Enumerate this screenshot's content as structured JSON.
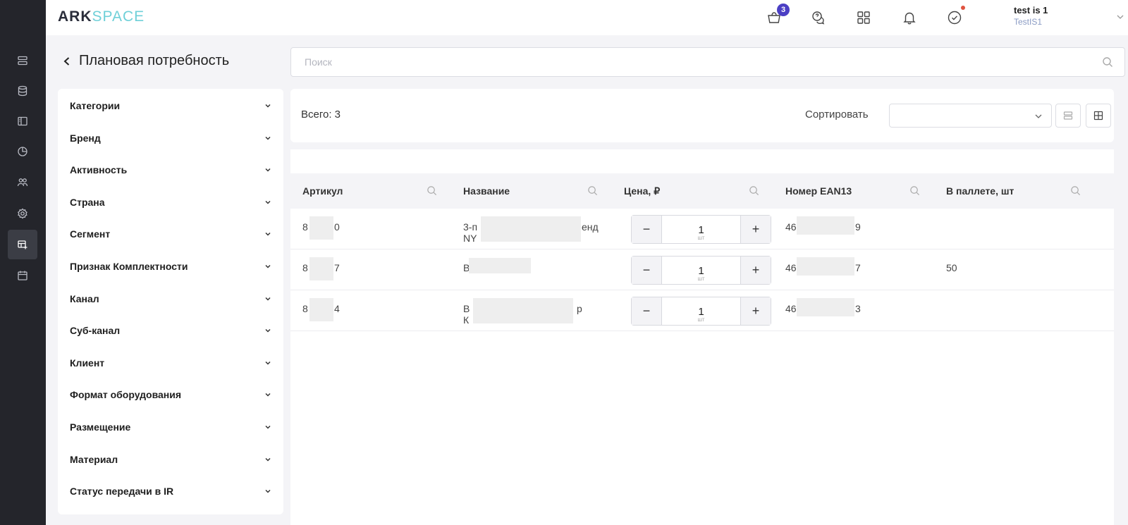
{
  "app": {
    "logo_ark": "ARK",
    "logo_space": "SPACE"
  },
  "header": {
    "cart_count": "3",
    "user_name": "test is 1",
    "user_org": "TestIS1",
    "icons": [
      "cart-icon",
      "chat-icon",
      "apps-grid-icon",
      "bell-icon",
      "check-circle-icon",
      "chevron-down-icon"
    ]
  },
  "sidebar": {
    "items": [
      "stack-icon",
      "database-icon",
      "layout-icon",
      "pie-chart-icon",
      "users-icon",
      "settings-icon",
      "table-add-icon",
      "calendar-icon"
    ],
    "active_index": 6
  },
  "page": {
    "title": "Плановая потребность"
  },
  "search": {
    "placeholder": "Поиск"
  },
  "filters": {
    "items": [
      "Категории",
      "Бренд",
      "Активность",
      "Страна",
      "Сегмент",
      "Признак Комплектности",
      "Канал",
      "Суб-канал",
      "Клиент",
      "Формат оборудования",
      "Размещение",
      "Материал",
      "Статус передачи в IR"
    ]
  },
  "toolbar": {
    "total_label": "Всего: 3",
    "sort_label": "Сортировать",
    "sort_value": ""
  },
  "table": {
    "columns": [
      "Артикул",
      "Название",
      "Цена, ₽",
      "Номер EAN13",
      "В паллете, шт"
    ],
    "rows": [
      {
        "article_start": "8",
        "article_end": "0",
        "name_line1_start": "3-п",
        "name_line1_end": "енд",
        "name_line2_start": "NY",
        "qty": "1",
        "unit": "шт",
        "ean_start": "46",
        "ean_end": "9",
        "pallet": ""
      },
      {
        "article_start": "8",
        "article_end": "7",
        "name_line1_start": "В",
        "name_line1_end": "",
        "name_line2_start": "",
        "qty": "1",
        "unit": "шт",
        "ean_start": "46",
        "ean_end": "7",
        "pallet": "50"
      },
      {
        "article_start": "8",
        "article_end": "4",
        "name_line1_start": "В",
        "name_line1_end": "р",
        "name_line2_start": "К",
        "qty": "1",
        "unit": "шт",
        "ean_start": "46",
        "ean_end": "3",
        "pallet": ""
      }
    ]
  },
  "colors": {
    "accent": "#4b3fc4",
    "rail_bg": "#24252b",
    "logo_space": "#6fd0d8"
  }
}
